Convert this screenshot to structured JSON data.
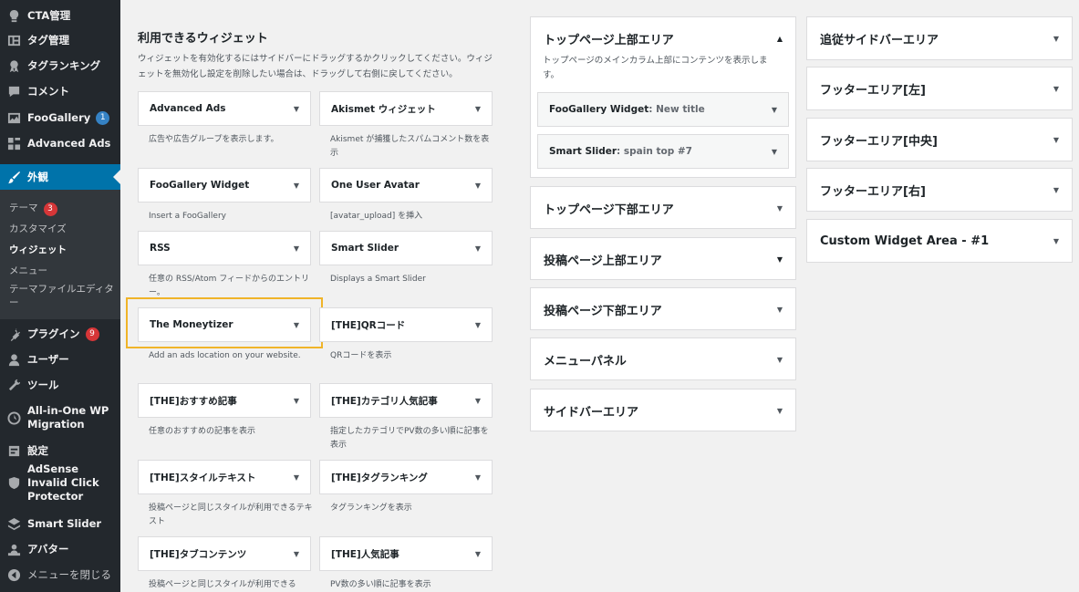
{
  "sidebar": {
    "items": [
      {
        "label": "CTA管理",
        "icon": "lightbulb-icon"
      },
      {
        "label": "タグ管理",
        "icon": "layout-icon"
      },
      {
        "label": "タグランキング",
        "icon": "award-icon"
      },
      {
        "label": "コメント",
        "icon": "comment-icon"
      },
      {
        "label": "FooGallery",
        "badge": "1",
        "icon": "gallery-icon"
      },
      {
        "label": "Advanced Ads",
        "icon": "ads-icon"
      },
      {
        "label": "外観",
        "icon": "brush-icon"
      },
      {
        "label": "プラグイン",
        "badge": "9",
        "icon": "plugin-icon"
      },
      {
        "label": "ユーザー",
        "icon": "user-icon"
      },
      {
        "label": "ツール",
        "icon": "wrench-icon"
      },
      {
        "label": "All-in-One WP Migration",
        "icon": "migration-icon"
      },
      {
        "label": "設定",
        "icon": "settings-icon"
      },
      {
        "label": "AdSense Invalid Click Protector",
        "icon": "shield-icon"
      },
      {
        "label": "Smart Slider",
        "icon": "slider-icon"
      },
      {
        "label": "アバター",
        "icon": "avatar-icon"
      },
      {
        "label": "メニューを閉じる",
        "icon": "collapse-icon"
      }
    ],
    "submenu": [
      {
        "label": "テーマ",
        "badge": "3"
      },
      {
        "label": "カスタマイズ"
      },
      {
        "label": "ウィジェット"
      },
      {
        "label": "メニュー"
      },
      {
        "label": "テーマファイルエディター"
      }
    ]
  },
  "available": {
    "title": "利用できるウィジェット",
    "description": "ウィジェットを有効化するにはサイドバーにドラッグするかクリックしてください。ウィジェットを無効化し設定を削除したい場合は、ドラッグして右側に戻してください。",
    "widgets": [
      {
        "name": "Advanced Ads",
        "desc": "広告や広告グループを表示します。"
      },
      {
        "name": "Akismet ウィジェット",
        "desc": "Akismet が捕獲したスパムコメント数を表示"
      },
      {
        "name": "FooGallery Widget",
        "desc": "Insert a FooGallery"
      },
      {
        "name": "One User Avatar",
        "desc": "[avatar_upload] を挿入"
      },
      {
        "name": "RSS",
        "desc": "任意の RSS/Atom フィードからのエントリー。"
      },
      {
        "name": "Smart Slider",
        "desc": "Displays a Smart Slider"
      },
      {
        "name": "The Moneytizer",
        "desc": "Add an ads location on your website."
      },
      {
        "name": "[THE]QRコード",
        "desc": "QRコードを表示"
      },
      {
        "name": "[THE]おすすめ記事",
        "desc": "任意のおすすめの記事を表示"
      },
      {
        "name": "[THE]カテゴリ人気記事",
        "desc": "指定したカテゴリでPV数の多い順に記事を表示"
      },
      {
        "name": "[THE]スタイルテキスト",
        "desc": "投稿ページと同じスタイルが利用できるテキスト"
      },
      {
        "name": "[THE]タグランキング",
        "desc": "タグランキングを表示"
      },
      {
        "name": "[THE]タブコンテンツ",
        "desc": "投稿ページと同じスタイルが利用できる"
      },
      {
        "name": "[THE]人気記事",
        "desc": "PV数の多い順に記事を表示"
      }
    ]
  },
  "areas_mid": [
    {
      "title": "トップページ上部エリア",
      "desc": "トップページのメインカラム上部にコンテンツを表示します。",
      "widgets": [
        {
          "title": "FooGallery Widget",
          "sub": ": New title"
        },
        {
          "title": "Smart Slider",
          "sub": ": spain top #7"
        }
      ]
    },
    {
      "title": "トップページ下部エリア"
    },
    {
      "title": "投稿ページ上部エリア"
    },
    {
      "title": "投稿ページ下部エリア"
    },
    {
      "title": "メニューパネル"
    },
    {
      "title": "サイドバーエリア"
    }
  ],
  "areas_right": [
    {
      "title": "追従サイドバーエリア"
    },
    {
      "title": "フッターエリア[左]"
    },
    {
      "title": "フッターエリア[中央]"
    },
    {
      "title": "フッターエリア[右]"
    },
    {
      "title": "Custom Widget Area - #1"
    }
  ],
  "caret": "▼",
  "caret_up": "▲",
  "colors": {
    "sidebar_bg": "#23282d",
    "active": "#0073aa",
    "highlight": "#f0b429"
  }
}
